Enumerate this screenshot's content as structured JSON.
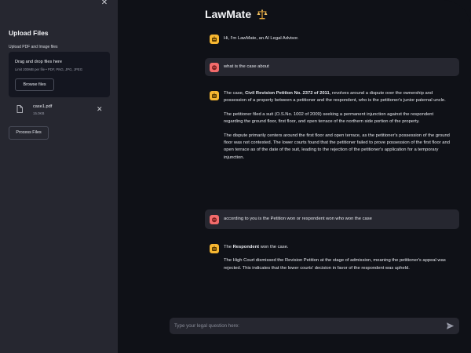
{
  "sidebar": {
    "title": "Upload Files",
    "subtitle": "Upload PDF and Image files",
    "dropzone": {
      "title": "Drag and drop files here",
      "limit": "Limit 200MB per file • PDF, PNG, JPG, JPEG",
      "browse_label": "Browse files"
    },
    "file": {
      "name": "case1.pdf",
      "size": "15.0KB"
    },
    "process_label": "Process Files"
  },
  "app": {
    "title": "LawMate"
  },
  "chat": {
    "greeting": "Hi, I'm LawMate, an AI Legal Advisor.",
    "user1": "what is the case about",
    "answer1": {
      "p1_pre": "The case, ",
      "p1_bold": "Civil Revision Petition No. 2372 of 2011",
      "p1_post": ", revolves around a dispute over the ownership and possession of a property between a petitioner and the respondent, who is the petitioner's junior paternal uncle.",
      "p2": "The petitioner filed a suit (O.S.No. 1002 of 2009) seeking a permanent injunction against the respondent regarding the ground floor, first floor, and open terrace of the northern side portion of the property.",
      "p3": "The dispute primarily centers around the first floor and open terrace, as the petitioner's possession of the ground floor was not contested. The lower courts found that the petitioner failed to prove possession of the first floor and open terrace as of the date of the suit, leading to the rejection of the petitioner's application for a temporary injunction."
    },
    "user2": "according to you is the Petition won or respondent won who won the case",
    "answer2": {
      "p1_pre": "The ",
      "p1_bold": "Respondent",
      "p1_post": " won the case.",
      "p2": "The High Court dismissed the Revision Petition at the stage of admission, meaning the petitioner's appeal was rejected. This indicates that the lower courts' decision in favor of the respondent was upheld."
    }
  },
  "input": {
    "placeholder": "Type your legal question here:"
  },
  "icons": {
    "close": "close-icon",
    "file": "file-icon",
    "remove": "remove-icon",
    "scale": "scale-icon",
    "bot": "bot-avatar-icon",
    "user": "user-avatar-icon",
    "send": "send-icon"
  },
  "colors": {
    "background": "#0f1117",
    "sidebar": "#262730",
    "bot_avatar": "#f7b731",
    "user_avatar": "#f26b6b"
  }
}
